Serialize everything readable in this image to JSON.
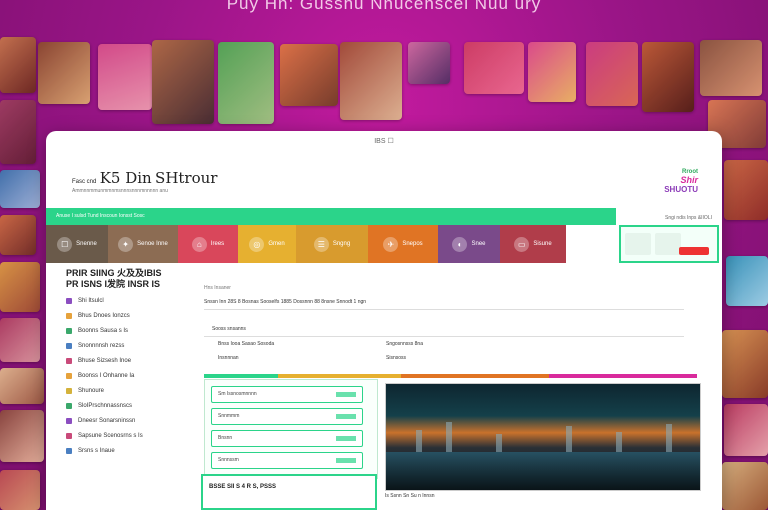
{
  "hero": {
    "title": "Puy Hn: Gusshu Nnucenscei Nuu ury"
  },
  "window": {
    "title": "IBS ☐"
  },
  "brand": {
    "prefix": "Fasc cnd",
    "name": "K5 Din",
    "title": "SHtrour",
    "subtitle": "Ammnnmmunmmnmsnnnsnnnmnnnnn anu"
  },
  "logo": {
    "line1": "Rroot",
    "line2": "Shir",
    "line3": "SHUOTU",
    "tagline": "Sngi ndis Inps &IIOLI"
  },
  "nav": {
    "green_bar_label": "Anuse I sulsd Tund Inscoun Ionsst Sosc",
    "categories": [
      {
        "label": "Snenne",
        "icon": "☐",
        "color": "#6a5a4a"
      },
      {
        "label": "Senoe Inne",
        "icon": "✦",
        "color": "#8c6c53"
      },
      {
        "label": "Irees",
        "icon": "⌂",
        "color": "#d9475b"
      },
      {
        "label": "Gmen",
        "icon": "◎",
        "color": "#e6b030"
      },
      {
        "label": "Sngng",
        "icon": "☰",
        "color": "#d89b2e"
      },
      {
        "label": "Snepos",
        "icon": "✈",
        "color": "#e07424"
      },
      {
        "label": "Snee",
        "icon": "◐",
        "color": "#7a4a8a"
      },
      {
        "label": "Sisune",
        "icon": "▭",
        "color": "#b03d4a"
      }
    ]
  },
  "sidebar": {
    "heading_line1": "PRIR SIING 火及及IBIS",
    "heading_line2": "PR ISNS I发院 INSR IS",
    "items": [
      {
        "label": "Shi Itsulcl",
        "color": "#8b4ec0"
      },
      {
        "label": "Bhus Dnoes Ionzcs",
        "color": "#e6a23c"
      },
      {
        "label": "Boonns Sausa s Is",
        "color": "#3aa86b"
      },
      {
        "label": "Snonnnnsh rezss",
        "color": "#4a7fc1"
      },
      {
        "label": "Bhuse Sizsesh Inoe",
        "color": "#c94a7a"
      },
      {
        "label": "Boonss I Onhanne Ia",
        "color": "#e6a23c"
      },
      {
        "label": "Shunoure",
        "color": "#d4b23b"
      },
      {
        "label": "SloIPrschnnassnscs",
        "color": "#3aa86b"
      },
      {
        "label": "Dneesr Sonarsninssn",
        "color": "#8b4ec0"
      },
      {
        "label": "Sapsune Scenosrns s Is",
        "color": "#c94a7a"
      },
      {
        "label": "Srsns s Inaue",
        "color": "#4a7fc1"
      }
    ]
  },
  "content": {
    "section_label": "Hns Insaner",
    "row1": "Snssn Inn 28S 8 Bosnas Sooselfs 1885 Dossnnn 88 8nsne Snnodt 1 ngn",
    "row2": "Sooss snsanns",
    "row3_left": "Bnss Iooa Sasao Sosoda",
    "row3_mid": "Sngosnnsss 8na",
    "row4_left": "Insnnnan",
    "row4_mid": "Sisnsoss"
  },
  "form": {
    "fields": [
      "Sm Issnosmnnnn",
      "Snnmmm",
      "Bnsnn",
      "Snnnssm"
    ]
  },
  "bottom": {
    "box_label": "BSSE SII S 4 R S, PSSS",
    "photo_caption": "Is Ssnn Sn Su n Innsn"
  },
  "colors": {
    "accent": "#2bd48a",
    "brand_pink": "#d92a9c",
    "bg": "#9a1587"
  }
}
